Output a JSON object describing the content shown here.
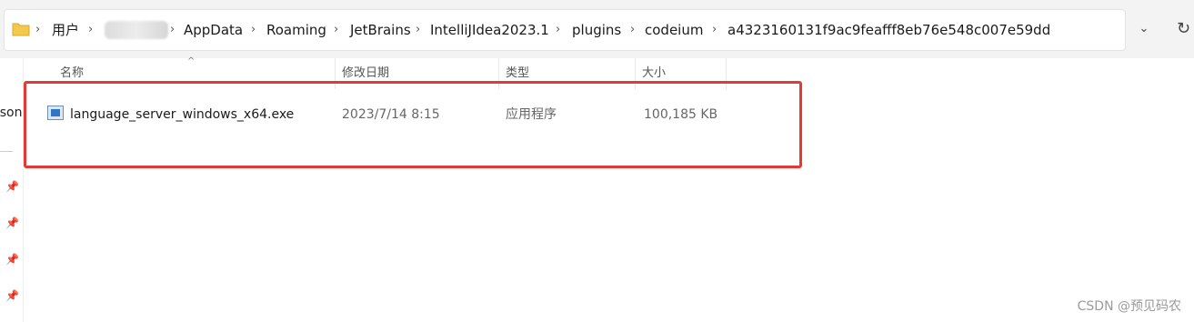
{
  "address_bar": {
    "crumbs": [
      "用户",
      "AppData",
      "Roaming",
      "JetBrains",
      "IntelliJIdea2023.1",
      "plugins",
      "codeium",
      "a4323160131f9ac9feafff8eb76e548c007e59dd"
    ],
    "separator": "›",
    "dropdown": "⌄",
    "refresh": "↻"
  },
  "nav": {
    "partial_label": "rson",
    "pins": [
      "📌",
      "📌",
      "📌",
      "📌"
    ]
  },
  "columns": {
    "name": "名称",
    "modified": "修改日期",
    "type": "类型",
    "size": "大小",
    "sort_indicator": "^"
  },
  "files": [
    {
      "name": "language_server_windows_x64.exe",
      "modified": "2023/7/14 8:15",
      "type": "应用程序",
      "size": "100,185 KB",
      "icon": "exe-file-icon"
    }
  ],
  "watermark": "CSDN @预见码农",
  "colors": {
    "highlight": "#e53935",
    "folder": "#f2c94c"
  }
}
